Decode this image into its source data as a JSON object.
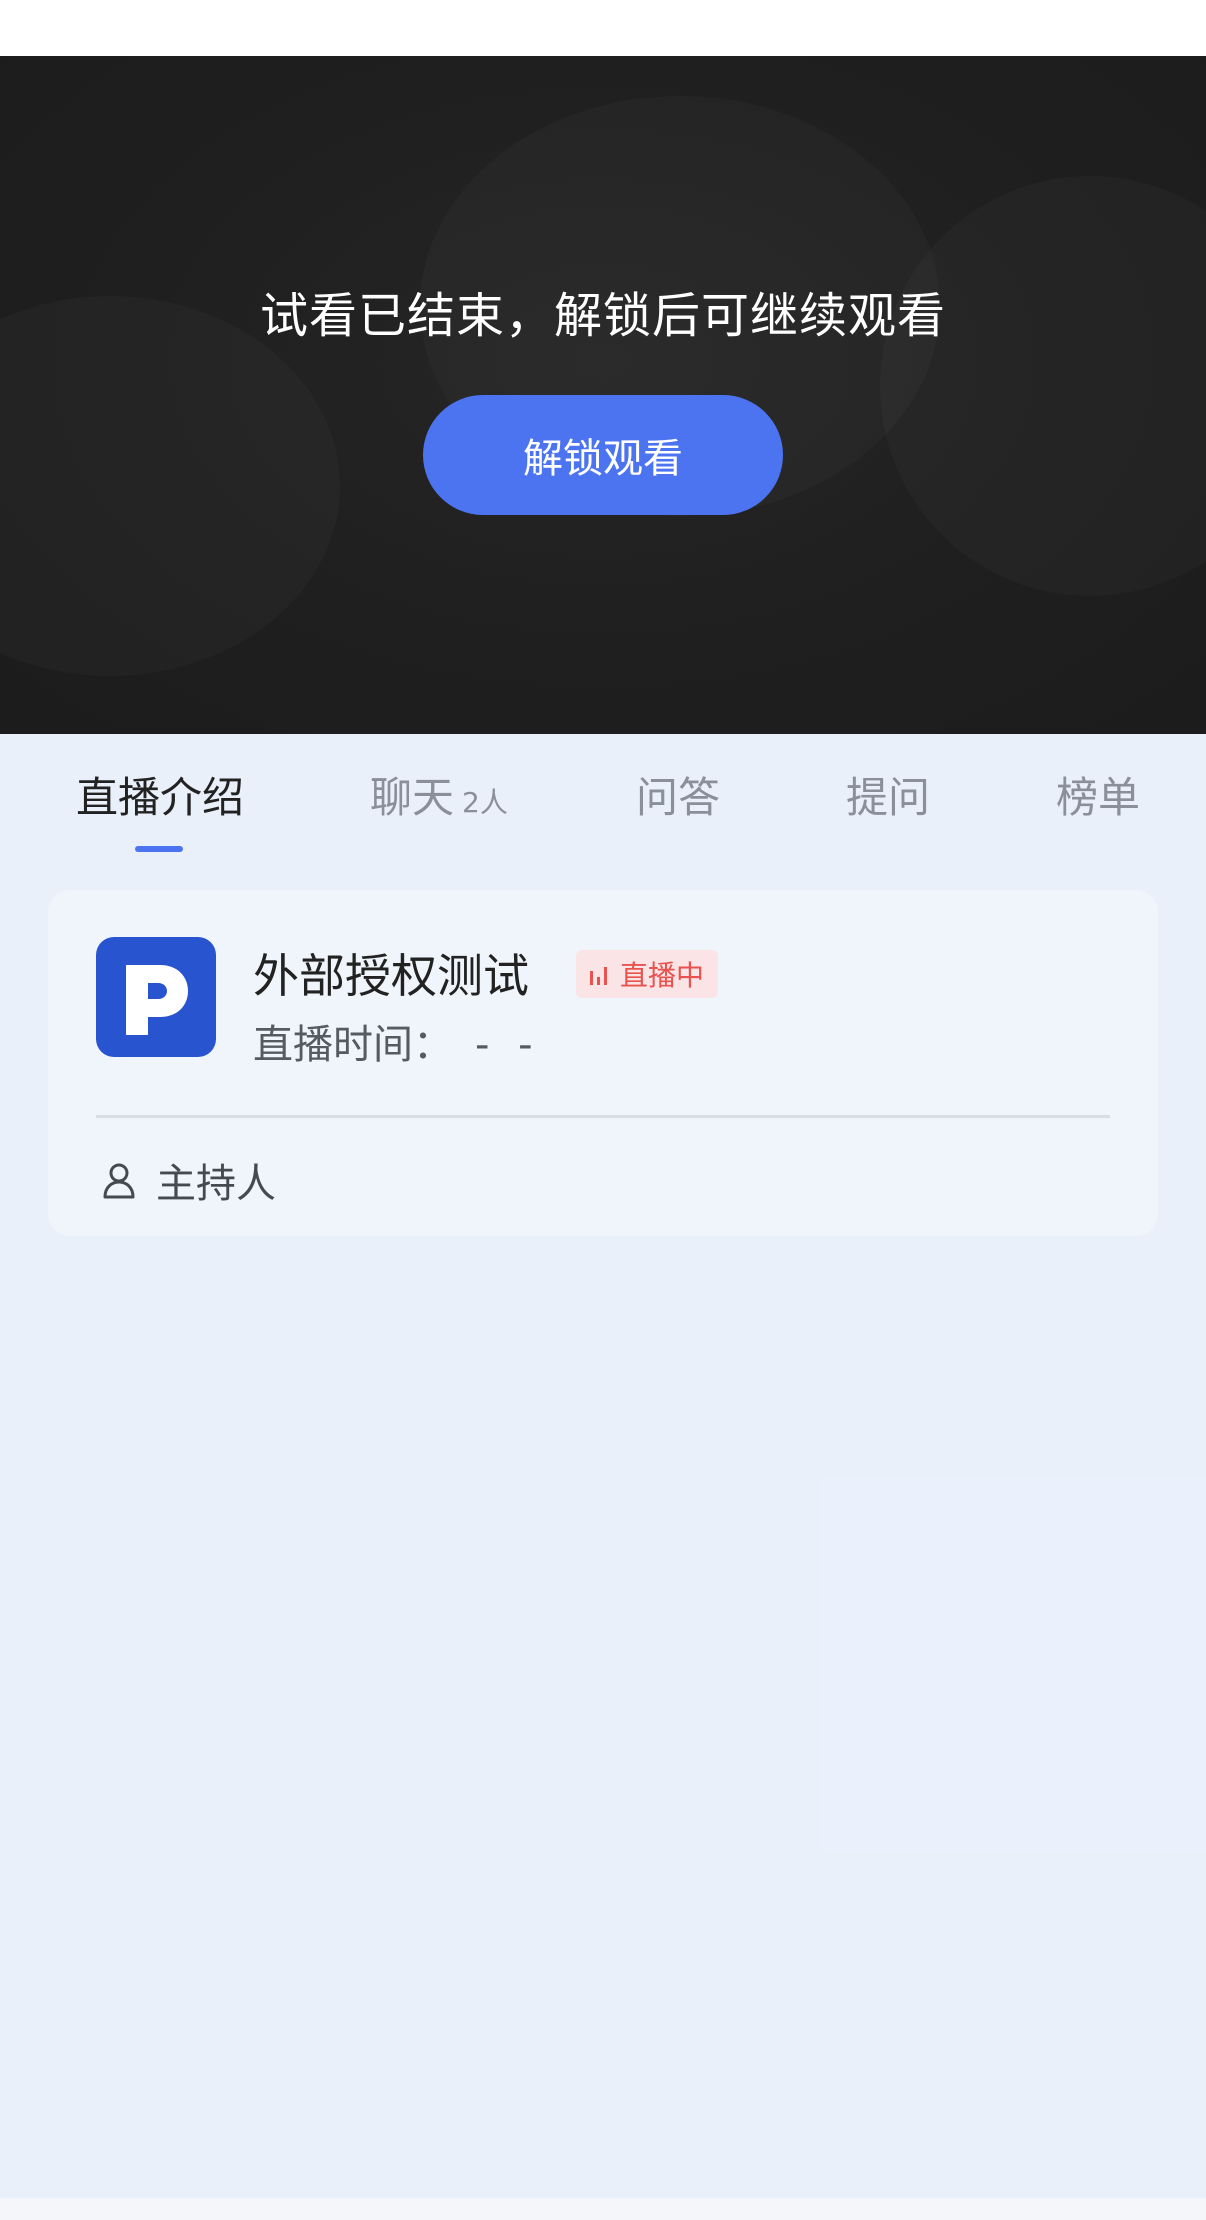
{
  "player": {
    "message": "试看已结束，解锁后可继续观看",
    "unlock_label": "解锁观看"
  },
  "tabs": [
    {
      "label": "直播介绍",
      "active": true
    },
    {
      "label": "聊天",
      "count": "2人",
      "active": false
    },
    {
      "label": "问答",
      "active": false
    },
    {
      "label": "提问",
      "active": false
    },
    {
      "label": "榜单",
      "active": false
    }
  ],
  "card": {
    "logo_icon": "polyv-p-logo",
    "title": "外部授权测试",
    "live_badge": "直播中",
    "time_label": "直播时间：",
    "time_value": "- -",
    "host_icon": "person-icon",
    "host_label": "主持人"
  },
  "colors": {
    "accent": "#4c74f0",
    "live_red": "#e8524f",
    "logo_blue": "#2854d0"
  }
}
